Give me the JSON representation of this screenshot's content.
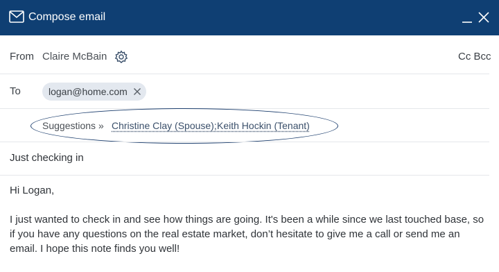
{
  "window": {
    "title": "Compose email"
  },
  "from": {
    "label": "From",
    "name": "Claire McBain",
    "cc_bcc": "Cc Bcc"
  },
  "to": {
    "label": "To",
    "recipients": [
      {
        "email": "logan@home.com"
      }
    ]
  },
  "suggestions": {
    "label": "Suggestions »",
    "items": [
      {
        "text": "Christine Clay (Spouse);"
      },
      {
        "text": "Keith Hockin (Tenant)"
      }
    ]
  },
  "subject": "Just checking in",
  "body": {
    "greeting": "Hi Logan,",
    "lines": [
      "I just wanted to check in and see how things are going. It's been a while since we last touched base, so",
      "if you have any questions on the real estate market, don’t hesitate to give me a call or send me an",
      "email. I hope this note finds you well!"
    ]
  },
  "icons": {
    "title": "mail-icon",
    "minimize": "minimize-icon",
    "close": "close-icon",
    "settings": "gear-icon",
    "remove_recipient": "remove-x-icon"
  },
  "colors": {
    "header": "#0f3f73",
    "chip": "#e3e8ef",
    "highlight_oval": "#1d3f6e"
  }
}
